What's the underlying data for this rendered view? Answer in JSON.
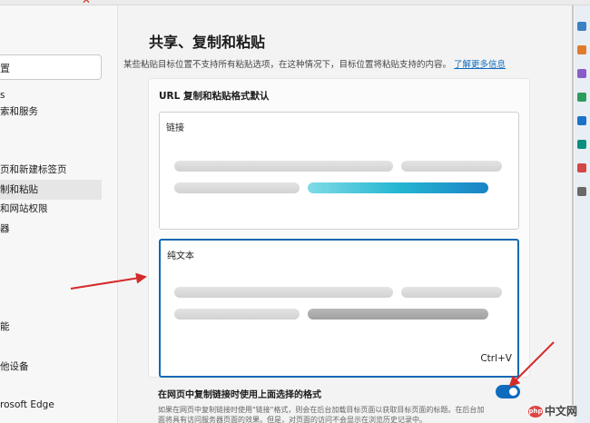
{
  "sidebar": {
    "search_fragment": "置",
    "items": [
      {
        "label": "s"
      },
      {
        "label": "索和服务"
      },
      {
        "label": "页和新建标签页"
      },
      {
        "label": "制和粘贴"
      },
      {
        "label": "和网站权限"
      },
      {
        "label": "器"
      },
      {
        "label": "能"
      },
      {
        "label": "他设备"
      },
      {
        "label": "rosoft Edge"
      }
    ]
  },
  "main": {
    "title": "共享、复制和粘贴",
    "description": "某些粘贴目标位置不支持所有粘贴选项，在这种情况下，目标位置将粘贴支持的内容。",
    "learn_more": "了解更多信息",
    "card_heading": "URL 复制和粘贴格式默认",
    "option_link_label": "链接",
    "option_plain_label": "纯文本",
    "option_plain_shortcut": "Ctrl+V",
    "toggle_label": "在网页中复制链接时使用上面选择的格式",
    "toggle_on": true,
    "footnote_line1": "如果在网页中复制链接时使用\"链接\"格式，则会在后台加载目标页面以获取目标页面的标题。在后台加",
    "footnote_line2": "面将具有访问服务器页面的效果。但是，对页面的访问不会显示在浏览历史记录中。"
  },
  "watermark": {
    "logo": "php",
    "text": "中文网"
  },
  "colors": {
    "accent": "#0f6cbd",
    "annotation_arrow": "#d42a2a"
  }
}
